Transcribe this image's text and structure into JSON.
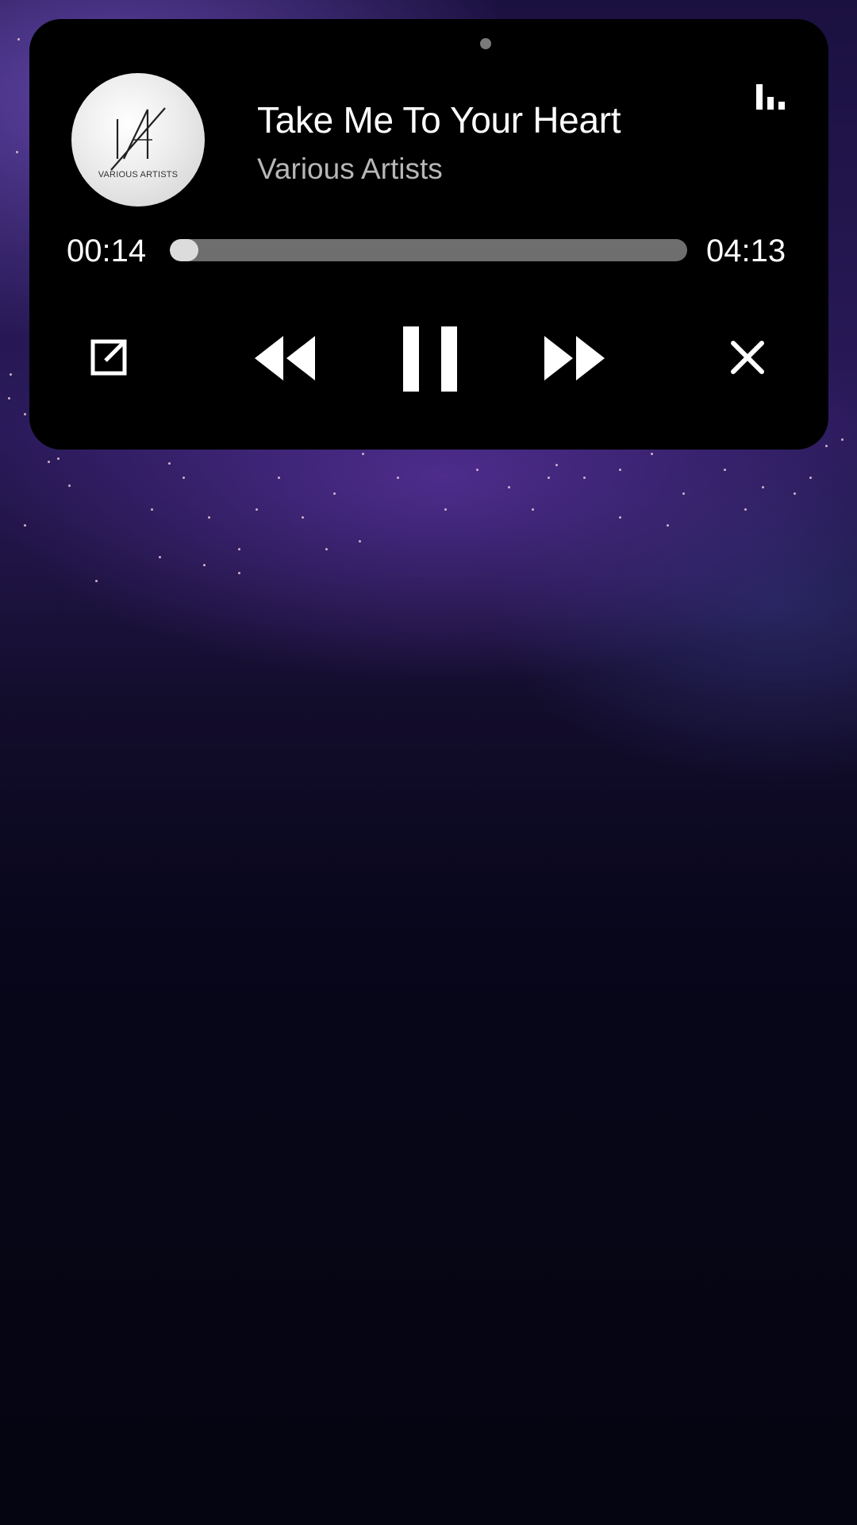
{
  "player": {
    "track_title": "Take Me To Your Heart",
    "artist": "Various Artists",
    "album_art_text": "VARIOUS ARTISTS",
    "elapsed": "00:14",
    "duration": "04:13",
    "progress_fraction": 0.055,
    "playback_state": "playing"
  },
  "icons": {
    "equalizer": "equalizer-icon",
    "popout": "open-external-icon",
    "rewind": "rewind-icon",
    "pause": "pause-icon",
    "forward": "fast-forward-icon",
    "close": "close-icon"
  },
  "colors": {
    "card_background": "#000000",
    "title_text": "#ffffff",
    "artist_text": "#b7b7b7",
    "progress_track": "#6e6e6e",
    "progress_fill": "#dcdcdc",
    "wallpaper_accent": "#5a3aa0"
  }
}
